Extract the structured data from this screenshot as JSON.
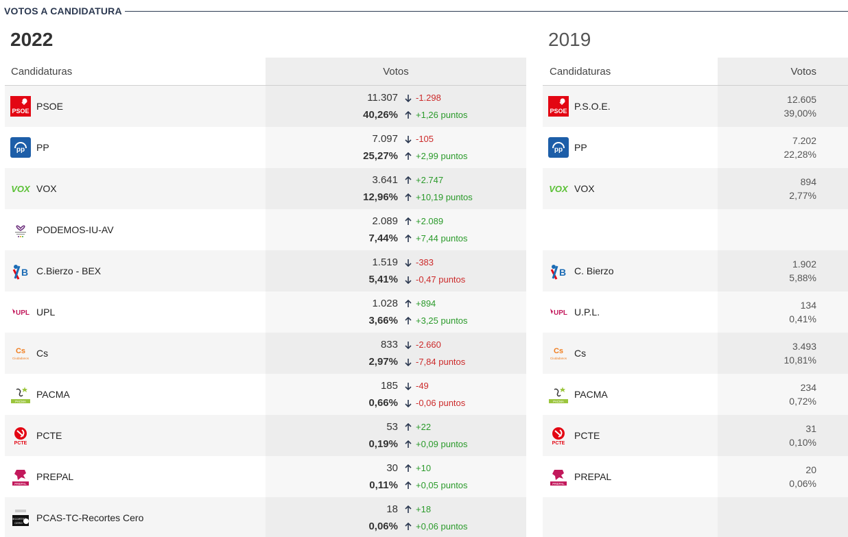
{
  "section_title": "VOTOS A CANDIDATURA",
  "years": {
    "current": "2022",
    "previous": "2019"
  },
  "headers": {
    "candidaturas": "Candidaturas",
    "votos": "Votos"
  },
  "colors": {
    "up": "#2a9a2a",
    "down": "#cc2a2a",
    "title": "#2b3850"
  },
  "rows_2022": [
    {
      "logo": "psoe-logo",
      "name": "PSOE",
      "votes": "11.307",
      "votes_diff": "-1.298",
      "votes_dir": "down",
      "pct": "40,26%",
      "pct_diff": "+1,26 puntos",
      "pct_dir": "up"
    },
    {
      "logo": "pp-logo",
      "name": "PP",
      "votes": "7.097",
      "votes_diff": "-105",
      "votes_dir": "down",
      "pct": "25,27%",
      "pct_diff": "+2,99 puntos",
      "pct_dir": "up"
    },
    {
      "logo": "vox-logo",
      "name": "VOX",
      "votes": "3.641",
      "votes_diff": "+2.747",
      "votes_dir": "up",
      "pct": "12,96%",
      "pct_diff": "+10,19 puntos",
      "pct_dir": "up"
    },
    {
      "logo": "unidas-podemos-logo",
      "name": "PODEMOS-IU-AV",
      "votes": "2.089",
      "votes_diff": "+2.089",
      "votes_dir": "up",
      "pct": "7,44%",
      "pct_diff": "+7,44 puntos",
      "pct_dir": "up"
    },
    {
      "logo": "bierzo-logo",
      "name": "C.Bierzo - BEX",
      "votes": "1.519",
      "votes_diff": "-383",
      "votes_dir": "down",
      "pct": "5,41%",
      "pct_diff": "-0,47 puntos",
      "pct_dir": "down"
    },
    {
      "logo": "upl-logo",
      "name": "UPL",
      "votes": "1.028",
      "votes_diff": "+894",
      "votes_dir": "up",
      "pct": "3,66%",
      "pct_diff": "+3,25 puntos",
      "pct_dir": "up"
    },
    {
      "logo": "cs-logo",
      "name": "Cs",
      "votes": "833",
      "votes_diff": "-2.660",
      "votes_dir": "down",
      "pct": "2,97%",
      "pct_diff": "-7,84 puntos",
      "pct_dir": "down"
    },
    {
      "logo": "pacma-logo",
      "name": "PACMA",
      "votes": "185",
      "votes_diff": "-49",
      "votes_dir": "down",
      "pct": "0,66%",
      "pct_diff": "-0,06 puntos",
      "pct_dir": "down"
    },
    {
      "logo": "pcte-logo",
      "name": "PCTE",
      "votes": "53",
      "votes_diff": "+22",
      "votes_dir": "up",
      "pct": "0,19%",
      "pct_diff": "+0,09 puntos",
      "pct_dir": "up"
    },
    {
      "logo": "prepal-logo",
      "name": "PREPAL",
      "votes": "30",
      "votes_diff": "+10",
      "votes_dir": "up",
      "pct": "0,11%",
      "pct_diff": "+0,05 puntos",
      "pct_dir": "up"
    },
    {
      "logo": "recortes-cero-logo",
      "name": "PCAS-TC-Recortes Cero",
      "votes": "18",
      "votes_diff": "+18",
      "votes_dir": "up",
      "pct": "0,06%",
      "pct_diff": "+0,06 puntos",
      "pct_dir": "up"
    }
  ],
  "rows_2019": [
    {
      "logo": "psoe-logo",
      "name": "P.S.O.E.",
      "votes": "12.605",
      "pct": "39,00%"
    },
    {
      "logo": "pp-logo",
      "name": "PP",
      "votes": "7.202",
      "pct": "22,28%"
    },
    {
      "logo": "vox-logo",
      "name": "VOX",
      "votes": "894",
      "pct": "2,77%"
    },
    {
      "logo": "",
      "name": "",
      "votes": "",
      "pct": ""
    },
    {
      "logo": "bierzo-logo",
      "name": "C. Bierzo",
      "votes": "1.902",
      "pct": "5,88%"
    },
    {
      "logo": "upl-logo",
      "name": "U.P.L.",
      "votes": "134",
      "pct": "0,41%"
    },
    {
      "logo": "cs-logo",
      "name": "Cs",
      "votes": "3.493",
      "pct": "10,81%"
    },
    {
      "logo": "pacma-logo",
      "name": "PACMA",
      "votes": "234",
      "pct": "0,72%"
    },
    {
      "logo": "pcte-logo",
      "name": "PCTE",
      "votes": "31",
      "pct": "0,10%"
    },
    {
      "logo": "prepal-logo",
      "name": "PREPAL",
      "votes": "20",
      "pct": "0,06%"
    },
    {
      "logo": "",
      "name": "",
      "votes": "",
      "pct": ""
    }
  ]
}
